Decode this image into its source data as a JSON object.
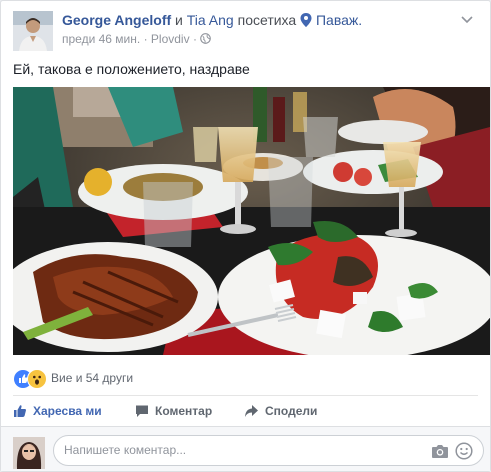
{
  "post": {
    "author": "George Angeloff",
    "and_word": "и",
    "tagged": "Tia Ang",
    "verb": "посетиха",
    "place": "Паваж.",
    "time": "преди 46 мин.",
    "dot": "·",
    "location": "Plovdiv",
    "status_text": "Ей, такова е положението, наздраве"
  },
  "reactions": {
    "count_text": "Вие и 54 други",
    "types": [
      "like",
      "wow"
    ]
  },
  "actions": {
    "like": "Харесва ми",
    "comment": "Коментар",
    "share": "Сподели"
  },
  "composer": {
    "placeholder": "Напишете коментар..."
  },
  "colors": {
    "link": "#365899",
    "like_blue": "#4267b2",
    "wow_yellow": "#f7c33f"
  }
}
